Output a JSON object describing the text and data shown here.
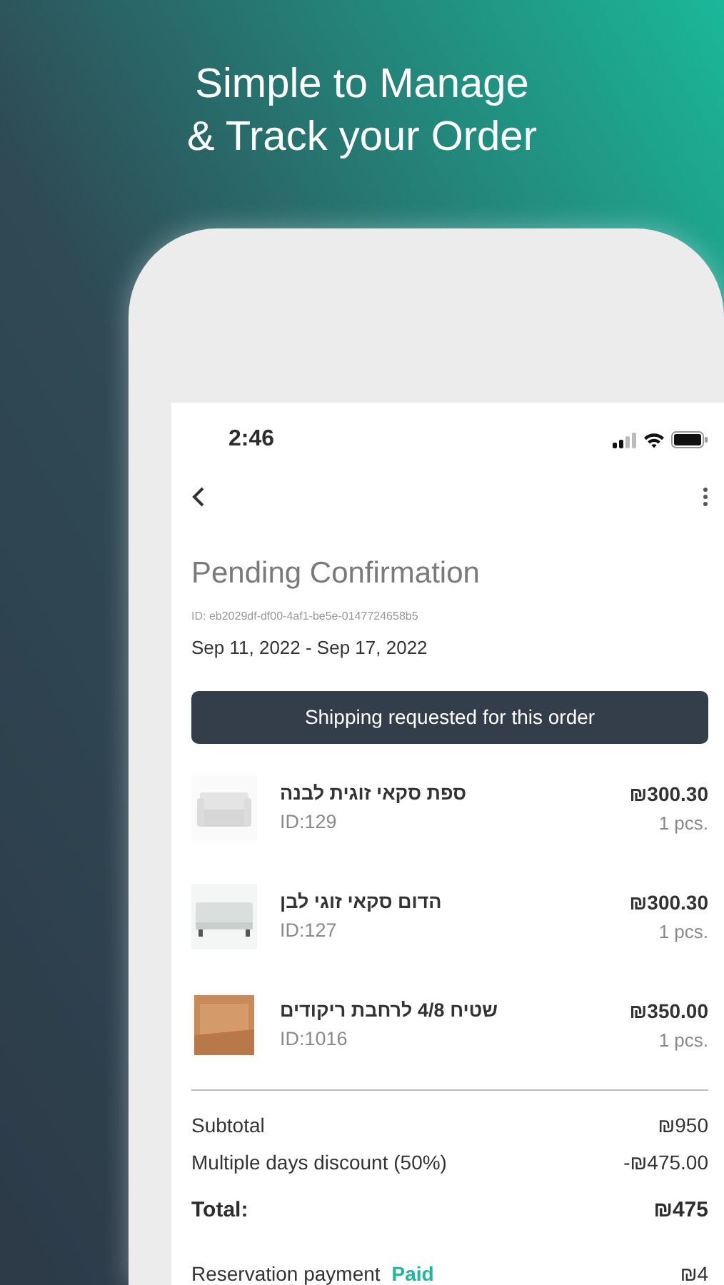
{
  "headline": [
    "Simple to Manage",
    "& Track your Order"
  ],
  "status_bar": {
    "time": "2:46"
  },
  "title": "Pending Confirmation",
  "order_id": "ID: eb2029df-df00-4af1-be5e-0147724658b5",
  "dates": "Sep 11, 2022 - Sep 17, 2022",
  "banner": "Shipping requested for this order",
  "items": [
    {
      "kind": "sofa",
      "name": "ספת סקאי זוגית לבנה",
      "id": "ID:129",
      "price": "₪300.30",
      "qty": "1 pcs."
    },
    {
      "kind": "bench",
      "name": "הדום סקאי זוגי לבן",
      "id": "ID:127",
      "price": "₪300.30",
      "qty": "1 pcs."
    },
    {
      "kind": "rug",
      "name": "שטיח 4/8 לרחבת ריקודים",
      "id": "ID:1016",
      "price": "₪350.00",
      "qty": "1 pcs."
    }
  ],
  "summary": [
    {
      "kind": "line",
      "label": "Subtotal",
      "value": "₪950"
    },
    {
      "kind": "line",
      "label": "Multiple days discount (50%)",
      "value": "-₪475.00"
    },
    {
      "kind": "total",
      "label": "Total:",
      "value": "₪475"
    }
  ],
  "reservation": {
    "label": "Reservation payment",
    "status": "Paid",
    "value": "₪4"
  }
}
